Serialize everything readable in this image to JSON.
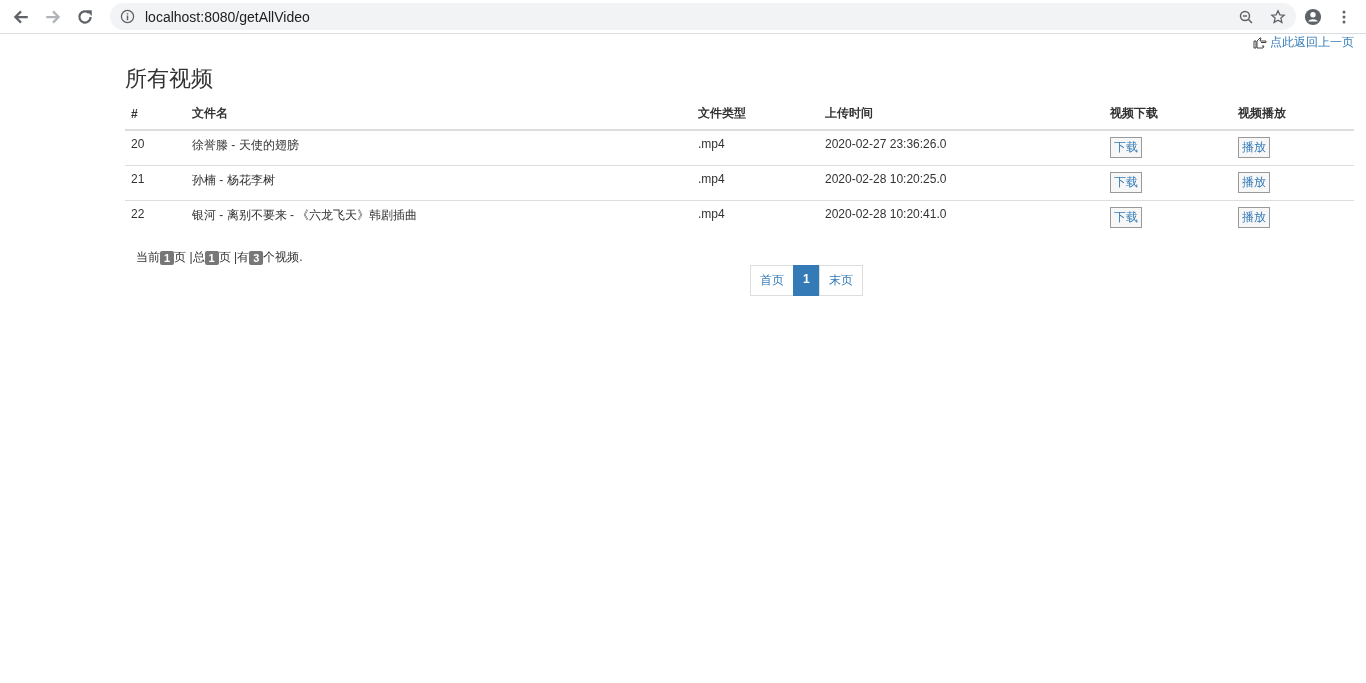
{
  "browser": {
    "url": "localhost:8080/getAllVideo"
  },
  "back_link": {
    "text": "点此返回上一页"
  },
  "title": "所有视频",
  "table": {
    "columns": [
      "#",
      "文件名",
      "文件类型",
      "上传时间",
      "视频下载",
      "视频播放"
    ],
    "rows": [
      {
        "id": "20",
        "name": "徐誉滕 - 天使的翅膀",
        "type": ".mp4",
        "time": "2020-02-27 23:36:26.0",
        "download": "下载",
        "play": "播放"
      },
      {
        "id": "21",
        "name": "孙楠 - 杨花李树",
        "type": ".mp4",
        "time": "2020-02-28 10:20:25.0",
        "download": "下载",
        "play": "播放"
      },
      {
        "id": "22",
        "name": "银河 - 离别不要来 - 《六龙飞天》韩剧插曲",
        "type": ".mp4",
        "time": "2020-02-28 10:20:41.0",
        "download": "下载",
        "play": "播放"
      }
    ]
  },
  "summary": [
    {
      "kind": "text",
      "text": "当前"
    },
    {
      "kind": "badge",
      "text": "1"
    },
    {
      "kind": "text",
      "text": "页 |总"
    },
    {
      "kind": "badge",
      "text": "1"
    },
    {
      "kind": "text",
      "text": "页 |有"
    },
    {
      "kind": "badge",
      "text": "3"
    },
    {
      "kind": "text",
      "text": "个视频."
    }
  ],
  "pagination": [
    {
      "label": "首页",
      "selected": false
    },
    {
      "label": "1",
      "selected": true
    },
    {
      "label": "末页",
      "selected": false
    }
  ]
}
